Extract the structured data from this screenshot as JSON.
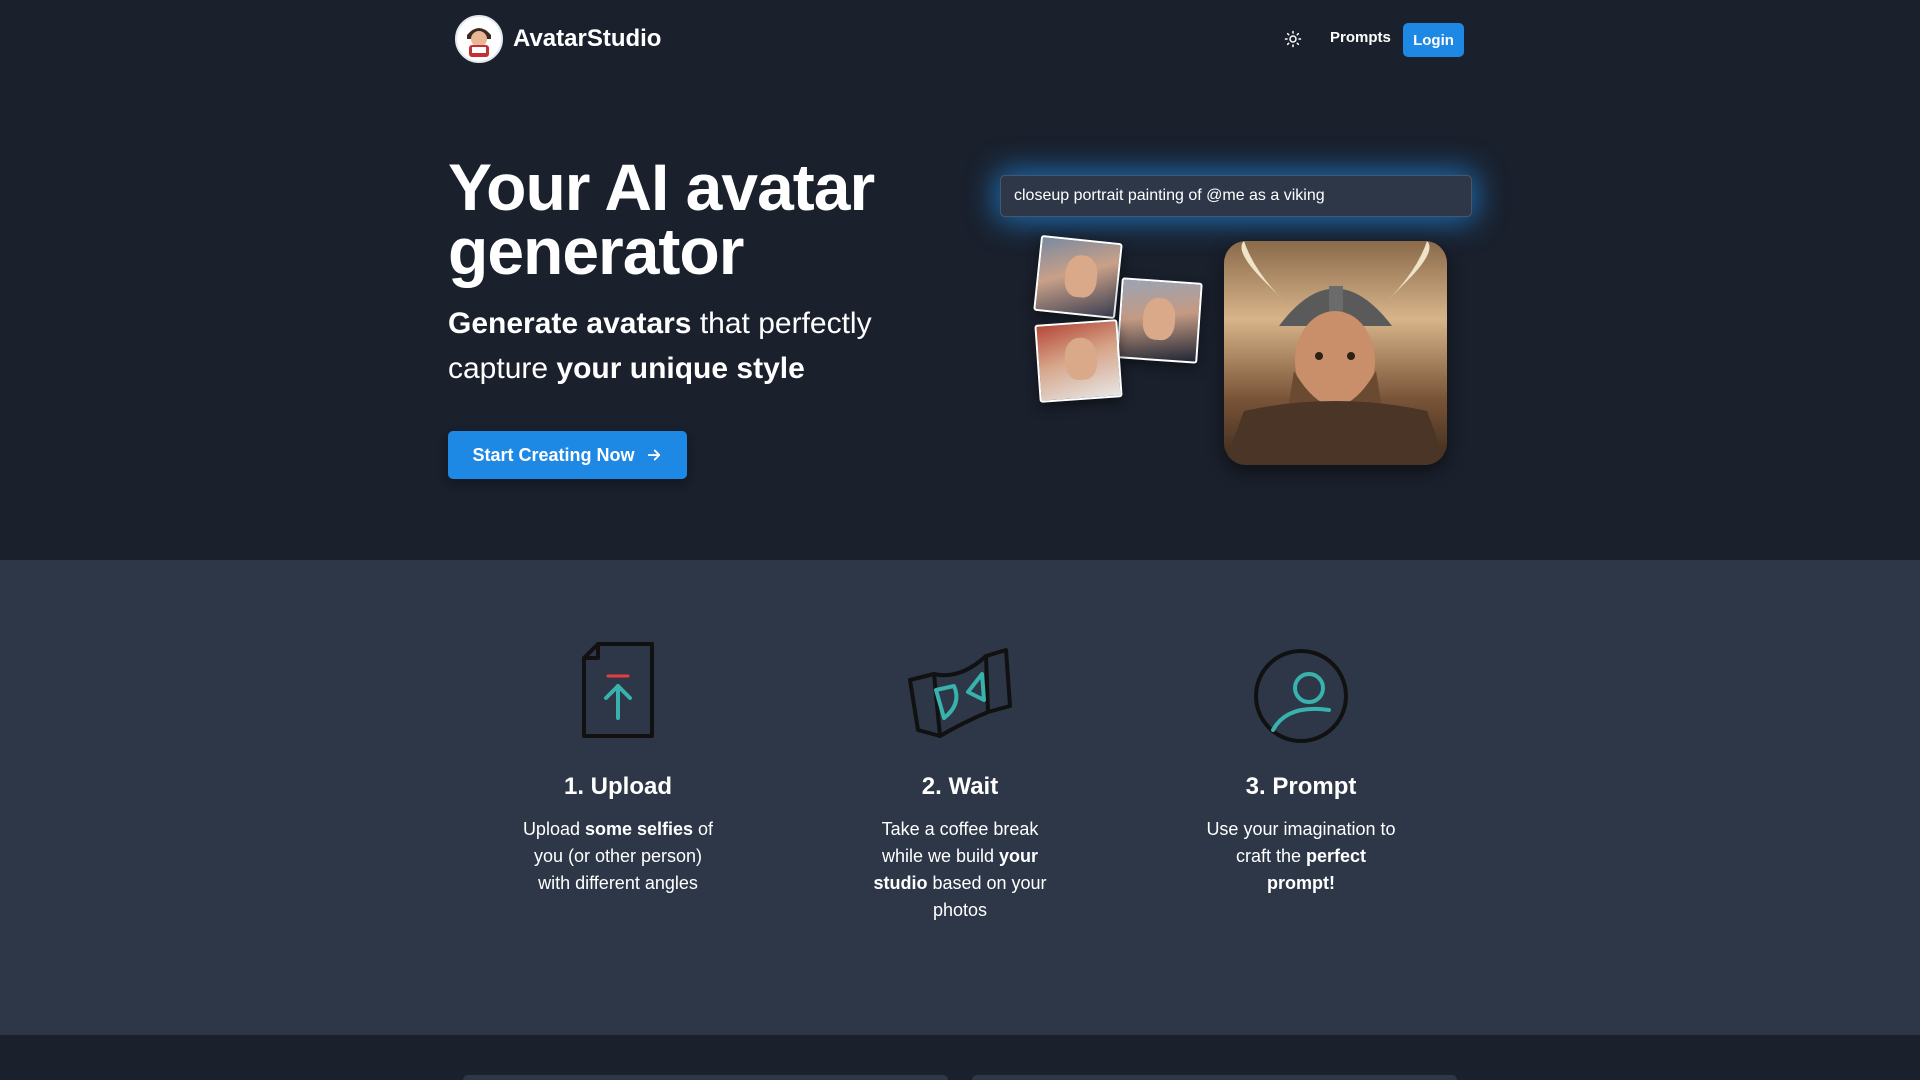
{
  "header": {
    "brand": "AvatarStudio",
    "theme_icon": "sun-icon",
    "nav_prompts": "Prompts",
    "login": "Login"
  },
  "hero": {
    "title": "Your AI avatar generator",
    "subtitle_part1": "Generate avatars",
    "subtitle_part2": " that perfectly capture ",
    "subtitle_part3": "your unique style",
    "cta_label": "Start Creating Now",
    "cta_icon": "arrow-right-icon",
    "prompt_example": "closeup portrait painting of @me as a viking"
  },
  "steps": [
    {
      "icon": "file-upload-icon",
      "title": "1. Upload",
      "text_a": "Upload ",
      "text_b": "some selfies",
      "text_c": " of you (or other person) with different angles"
    },
    {
      "icon": "hourglass-icon",
      "title": "2. Wait",
      "text_a": "Take a coffee break while we build ",
      "text_b": "your studio",
      "text_c": " based on your photos"
    },
    {
      "icon": "user-icon",
      "title": "3. Prompt",
      "text_a": "Use your imagination to craft the ",
      "text_b": "perfect prompt!",
      "text_c": ""
    }
  ],
  "colors": {
    "background": "#1a202c",
    "section": "#2d3748",
    "accent": "#1e88e5",
    "icon_accent": "#38b2ac"
  }
}
